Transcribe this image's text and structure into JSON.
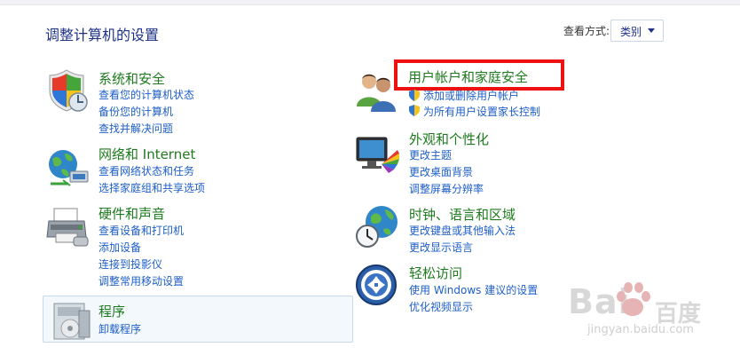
{
  "header": {
    "title": "调整计算机的设置",
    "view_by_label": "查看方式:",
    "view_by_value": "类别"
  },
  "left_column": {
    "system_security": {
      "title": "系统和安全",
      "links": [
        "查看您的计算机状态",
        "备份您的计算机",
        "查找并解决问题"
      ]
    },
    "network": {
      "title": "网络和 Internet",
      "links": [
        "查看网络状态和任务",
        "选择家庭组和共享选项"
      ]
    },
    "hardware_sound": {
      "title": "硬件和声音",
      "links": [
        "查看设备和打印机",
        "添加设备",
        "连接到投影仪",
        "调整常用移动设置"
      ]
    },
    "programs": {
      "title": "程序",
      "links": [
        "卸载程序"
      ]
    }
  },
  "right_column": {
    "user_accounts": {
      "title": "用户帐户和家庭安全",
      "links": [
        "添加或删除用户帐户",
        "为所有用户设置家长控制"
      ]
    },
    "appearance": {
      "title": "外观和个性化",
      "links": [
        "更改主题",
        "更改桌面背景",
        "调整屏幕分辨率"
      ]
    },
    "clock_region": {
      "title": "时钟、语言和区域",
      "links": [
        "更改键盘或其他输入法",
        "更改显示语言"
      ]
    },
    "ease_of_access": {
      "title": "轻松访问",
      "links": [
        "使用 Windows 建议的设置",
        "优化视频显示"
      ]
    }
  },
  "watermark": {
    "brand_left": "Bai",
    "brand_right": "百度",
    "site": "jingyan.baidu.com"
  },
  "colors": {
    "title_green": "#1e7a1e",
    "link_blue": "#1d5ec7",
    "highlight_red": "#ee1111",
    "header_blue": "#1e3287"
  }
}
